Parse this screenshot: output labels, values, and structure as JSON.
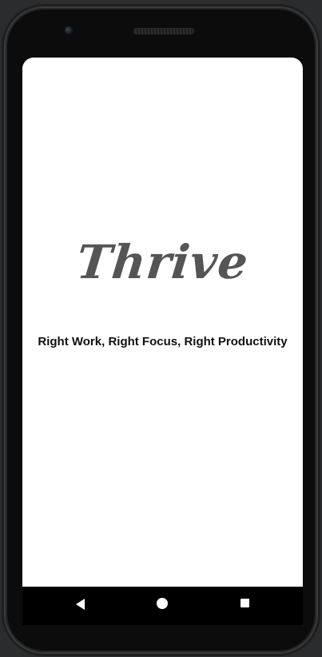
{
  "app": {
    "logo_text": "Thrive",
    "tagline": "Right Work, Right Focus, Right Productivity"
  },
  "navigation": {
    "back_icon": "back-triangle-icon",
    "home_icon": "home-circle-icon",
    "recents_icon": "recents-square-icon"
  },
  "colors": {
    "logo": "#555555",
    "tagline": "#111111",
    "screen_background": "#ffffff",
    "device_frame": "#0c0c0c",
    "nav_background": "#000000"
  }
}
